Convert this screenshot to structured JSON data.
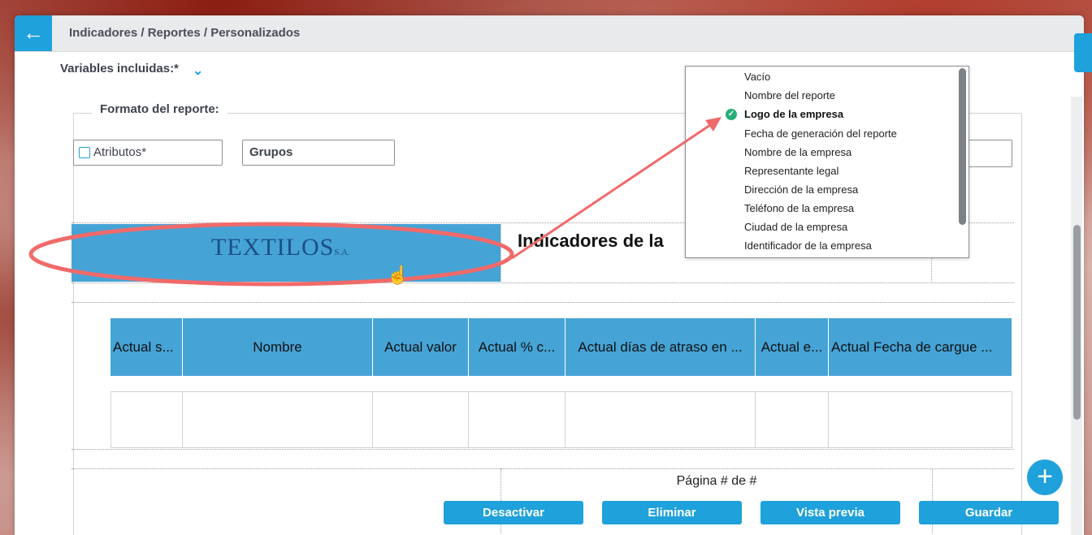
{
  "window": {
    "back_icon": "arrow-left-icon",
    "breadcrumb": "Indicadores / Reportes / Personalizados"
  },
  "form": {
    "variables_label": "Variables incluidas:*",
    "format_legend": "Formato del reporte:",
    "attributes_label": "Atributos*",
    "groups_label": "Grupos"
  },
  "report": {
    "logo_text": "TEXTILOS",
    "logo_suffix": "S.A.",
    "title": "Indicadores de la",
    "columns": [
      "Actual s...",
      "Nombre",
      "Actual valor",
      "Actual % c...",
      "Actual días de atraso en ...",
      "Actual e...",
      "Actual Fecha de cargue ..."
    ],
    "footer_page": "Página # de #"
  },
  "dropdown": {
    "items": [
      {
        "label": "Vacío",
        "selected": false
      },
      {
        "label": "Nombre del reporte",
        "selected": false
      },
      {
        "label": "Logo de la empresa",
        "selected": true
      },
      {
        "label": "Fecha de generación del reporte",
        "selected": false
      },
      {
        "label": "Nombre de la empresa",
        "selected": false
      },
      {
        "label": "Representante legal",
        "selected": false
      },
      {
        "label": "Dirección de la empresa",
        "selected": false
      },
      {
        "label": "Teléfono de la empresa",
        "selected": false
      },
      {
        "label": "Ciudad de la empresa",
        "selected": false
      },
      {
        "label": "Identificador de la empresa",
        "selected": false
      }
    ]
  },
  "actions": {
    "deactivate": "Desactivar",
    "delete": "Eliminar",
    "preview": "Vista previa",
    "save": "Guardar"
  },
  "colors": {
    "accent": "#1fa1db",
    "header_cell": "#46a3d6",
    "annotation": "#f06a6a",
    "check": "#2aae78"
  }
}
